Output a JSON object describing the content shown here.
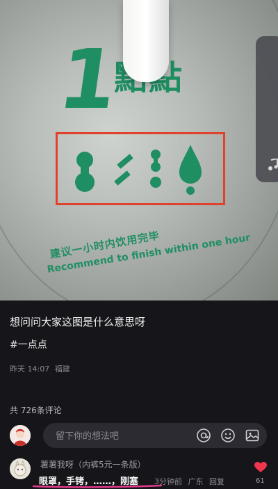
{
  "post": {
    "title": "想问问大家这图是什么意思呀",
    "tag": "#一点点",
    "time": "昨天 14:07",
    "location": "福建"
  },
  "image": {
    "brand_number": "1",
    "brand_name": "點點",
    "note_cn": "建议一小时内饮用完毕",
    "note_en": "Recommend to finish within one hour",
    "highlight_color": "#e0412a",
    "print_color": "#1f8e63"
  },
  "comments": {
    "count_label": "共 726条评论",
    "input_placeholder": "留下你的想法吧",
    "items": [
      {
        "user": "薯薯我呀（内裤5元一条版）",
        "text": "眼罩，手铐，……，刚塞",
        "time": "3分钟前",
        "location": "广东",
        "reply": "回复",
        "likes": "61"
      }
    ]
  },
  "icons": {
    "mention": "at-icon",
    "emoji": "emoji-icon",
    "image": "image-icon",
    "like": "heart-icon",
    "music": "music-note-icon"
  }
}
